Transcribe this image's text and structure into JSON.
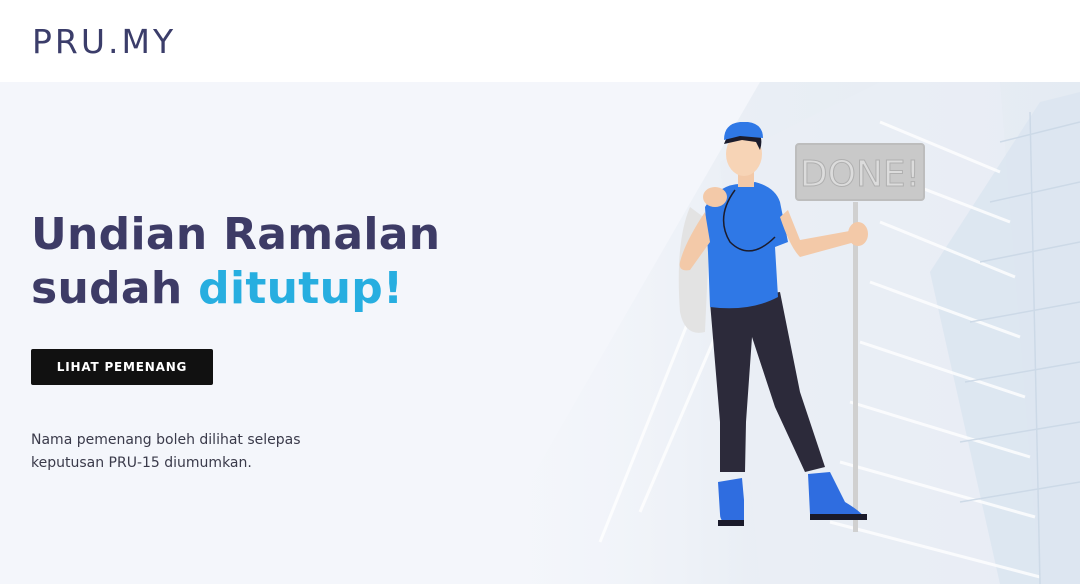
{
  "header": {
    "logo": "PRU.MY"
  },
  "hero": {
    "headline_part1": "Undian Ramalan",
    "headline_part2": "sudah ",
    "headline_accent": "ditutup!",
    "cta_label": "LIHAT PEMENANG",
    "note": "Nama pemenang boleh dilihat selepas keputusan PRU-15 diumumkan.",
    "sign_text": "DONE!"
  },
  "colors": {
    "headline": "#3d3b66",
    "accent": "#27aee0",
    "button_bg": "#111111",
    "logo": "#3b3d6a"
  },
  "icons": {
    "illustration": "man-holding-done-sign-illustration"
  }
}
